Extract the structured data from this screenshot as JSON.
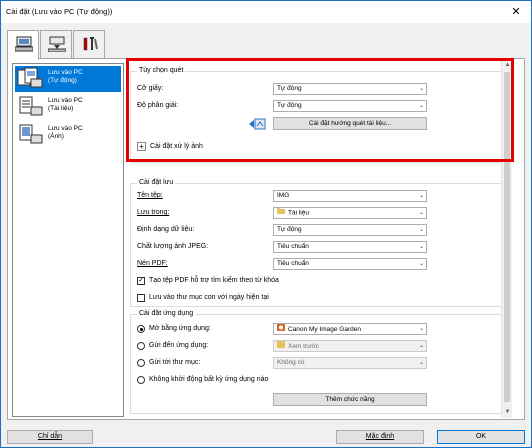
{
  "window": {
    "title": "Cài đặt (Lưu vào PC (Tự động))",
    "close_glyph": "✕"
  },
  "tabs": [
    {
      "icon": "scan-from-computer-icon"
    },
    {
      "icon": "scanner-to-pc-icon"
    },
    {
      "icon": "tools-icon"
    }
  ],
  "sidebar": {
    "items": [
      {
        "line1": "Lưu vào PC",
        "line2": "(Tự động)",
        "selected": true
      },
      {
        "line1": "Lưu vào PC",
        "line2": "(Tài liệu)",
        "selected": false
      },
      {
        "line1": "Lưu vào PC",
        "line2": "(Ảnh)",
        "selected": false
      }
    ]
  },
  "scan_options": {
    "title": "Tùy chọn quét",
    "paper_size_label": "Cỡ giấy:",
    "paper_size_value": "Tự động",
    "resolution_label": "Độ phân giải:",
    "resolution_value": "Tự động",
    "driver_settings_button": "Cài đặt hướng quét tài liệu...",
    "image_processing_label": "Cài đặt xử lý ảnh",
    "expand_glyph": "+"
  },
  "save_settings": {
    "title": "Cài đặt lưu",
    "file_name_label": "Tên tệp:",
    "file_name_value": "IMG",
    "save_in_label": "Lưu trong:",
    "save_in_value": "Tài liệu",
    "data_format_label": "Định dạng dữ liệu:",
    "data_format_value": "Tự động",
    "jpeg_quality_label": "Chất lượng ảnh JPEG:",
    "jpeg_quality_value": "Tiêu chuẩn",
    "pdf_compression_label": "Nén PDF:",
    "pdf_compression_value": "Tiêu chuẩn",
    "keyword_pdf_label": "Tạo tệp PDF hỗ trợ tìm kiếm theo từ khóa",
    "keyword_pdf_checked": true,
    "subfolder_label": "Lưu vào thư mục con với ngày hiện tại",
    "subfolder_checked": false,
    "check_glyph": "✓"
  },
  "app_settings": {
    "title": "Cài đặt ứng dụng",
    "open_with_label": "Mở bằng ứng dụng:",
    "open_with_value": "Canon My Image Garden",
    "send_to_app_label": "Gửi đến ứng dụng:",
    "send_to_app_value": "Xem trước",
    "send_to_folder_label": "Gửi tới thư mục:",
    "send_to_folder_value": "Không có",
    "do_not_start_label": "Không khởi động bất kỳ ứng dụng nào",
    "more_functions_button": "Thêm chức năng",
    "selected_option": "open_with"
  },
  "footer": {
    "help_button": "Chỉ dẫn",
    "defaults_button": "Mặc định",
    "ok_button": "OK"
  },
  "colors": {
    "highlight": "#e30000",
    "selection": "#0078d7"
  },
  "dropdown_arrow_glyph": "⌄",
  "scroll_up_glyph": "▲",
  "scroll_down_glyph": "▼"
}
